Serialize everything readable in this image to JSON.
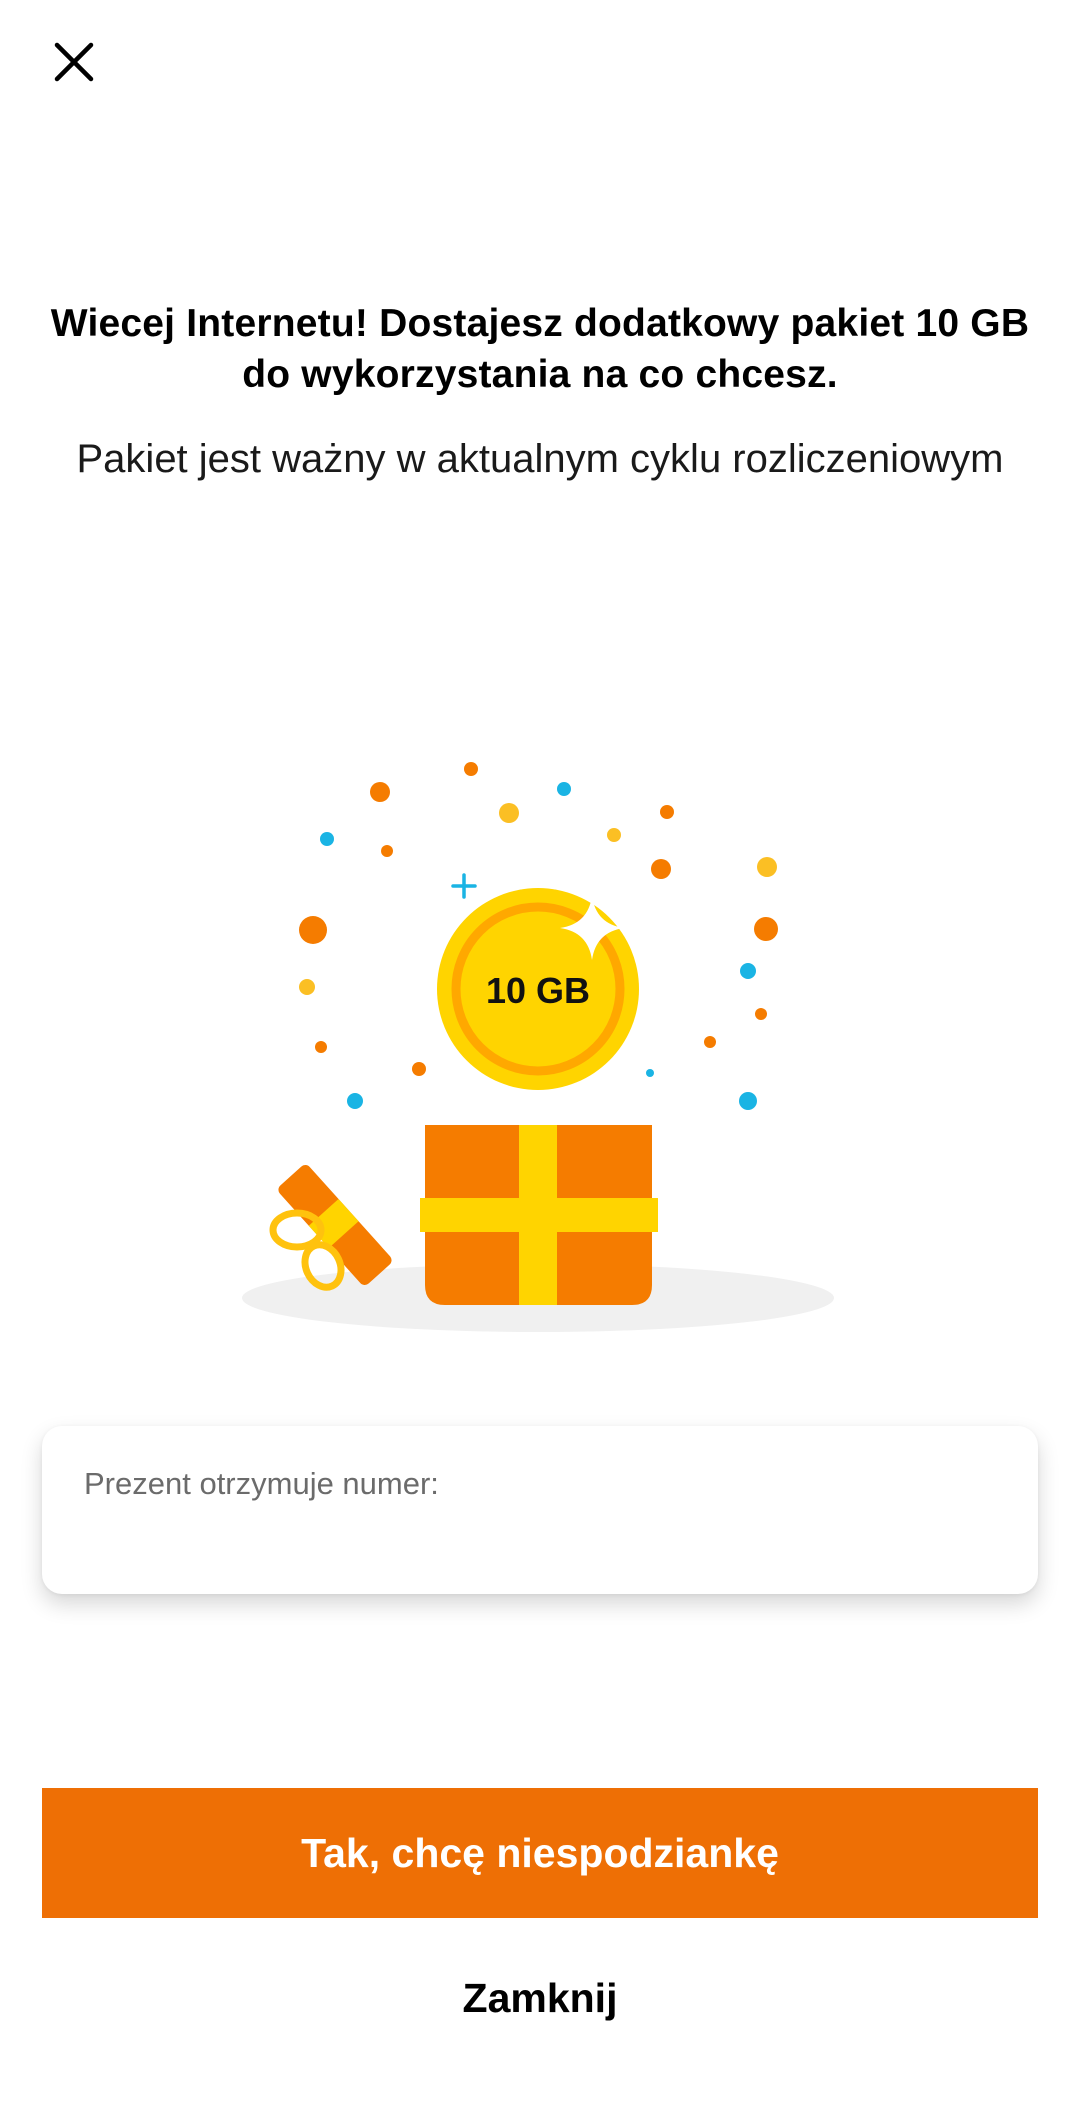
{
  "header": {
    "close_icon": "close-icon"
  },
  "content": {
    "title": "Wiecej Internetu! Dostajesz dodatkowy pakiet 10 GB do wykorzystania na co chcesz.",
    "subtitle": "Pakiet jest ważny w aktualnym cyklu rozliczeniowym"
  },
  "illustration": {
    "coin_label": "10 GB",
    "icon": "gift-box-coin-illustration",
    "colors": {
      "orange": "#f57c00",
      "yellow": "#ffd400",
      "blue": "#1ab4e4"
    }
  },
  "recipient": {
    "label": "Prezent otrzymuje numer:",
    "number": ""
  },
  "actions": {
    "confirm_label": "Tak, chcę niespodziankę",
    "close_label": "Zamknij"
  },
  "colors": {
    "accent": "#ee6f05"
  }
}
